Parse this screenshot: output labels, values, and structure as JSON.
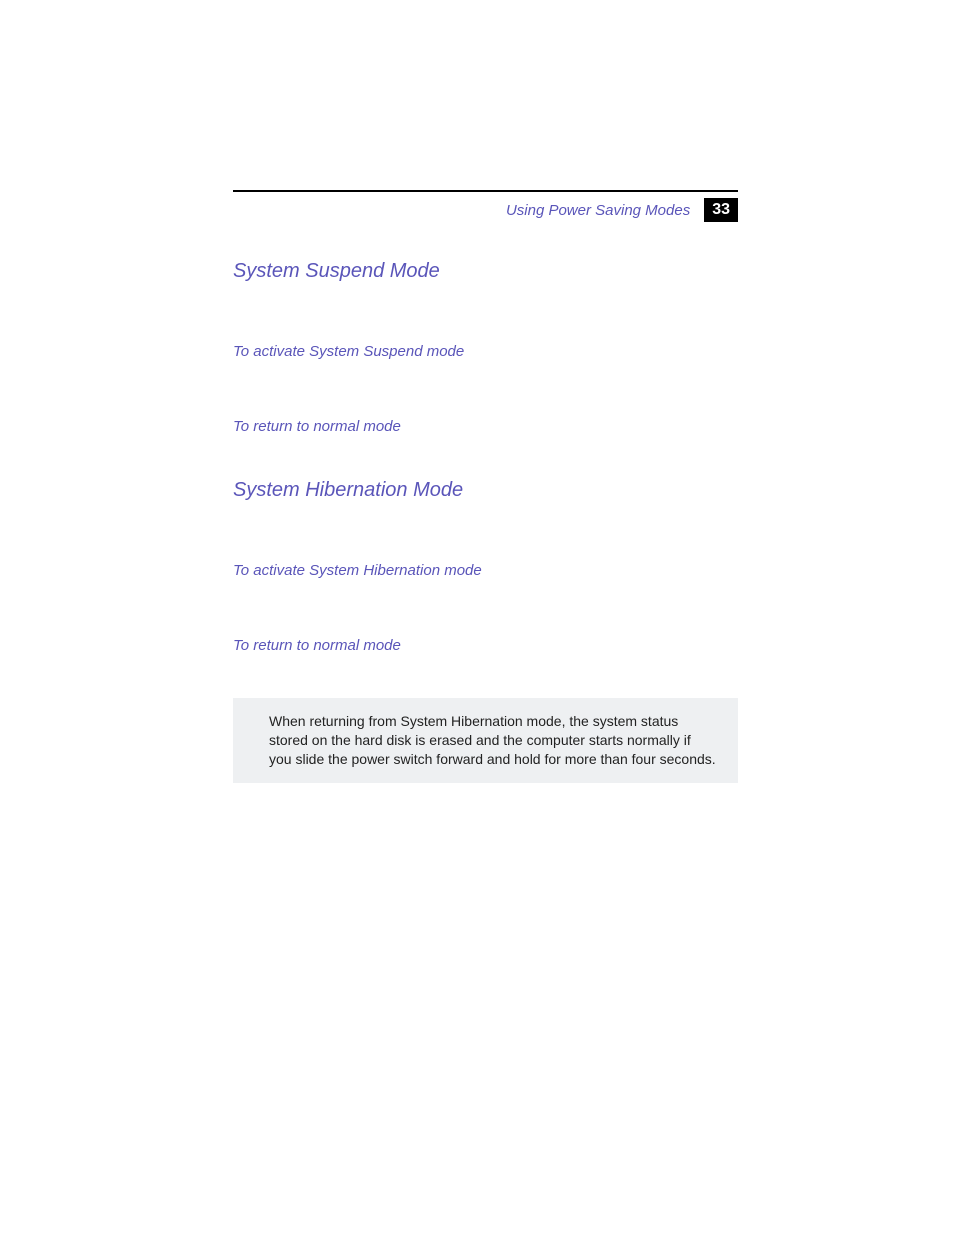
{
  "header": {
    "running_head": "Using Power Saving Modes",
    "page_number": "33"
  },
  "sections": {
    "suspend": {
      "title": "System Suspend Mode",
      "activate": "To activate System Suspend mode",
      "return": "To return to normal mode"
    },
    "hibernate": {
      "title": "System Hibernation Mode",
      "activate": "To activate System Hibernation mode",
      "return": "To return to normal mode"
    }
  },
  "note": "When returning from System Hibernation mode, the system status stored on the hard disk is erased and the computer starts normally if you slide the power switch forward and hold for more than four seconds."
}
